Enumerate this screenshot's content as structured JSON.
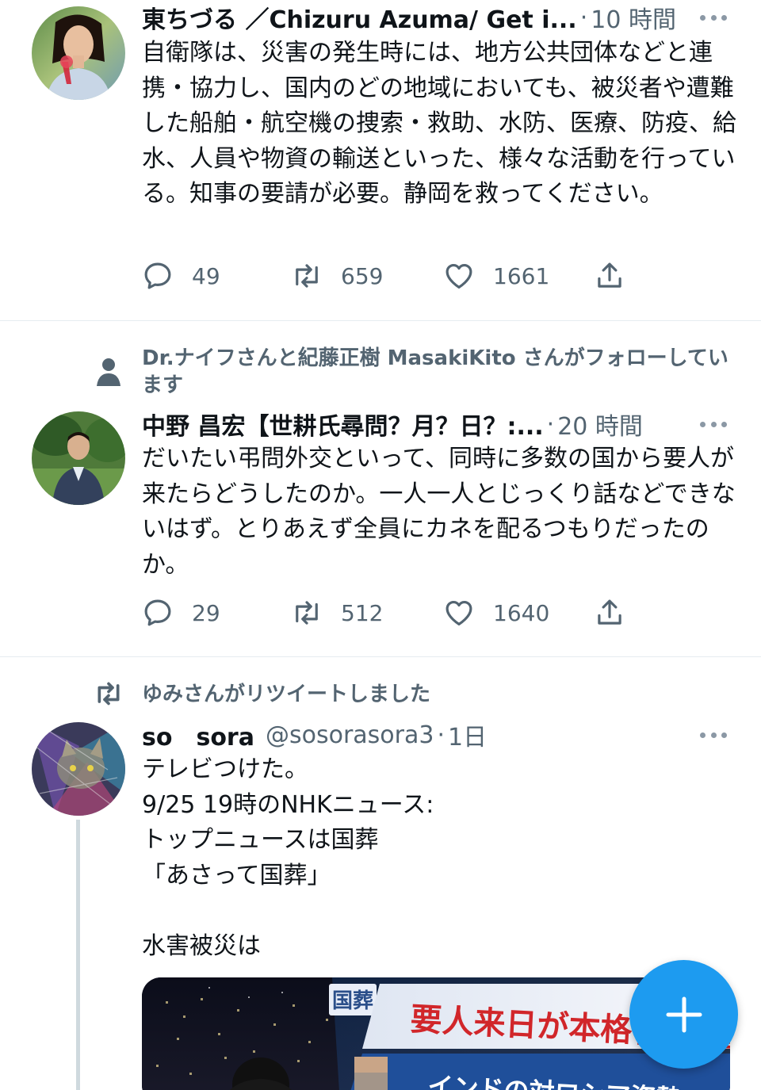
{
  "tweets": [
    {
      "author_name": "東ちづる ／Chizuru Azuma/ Get i...",
      "separator": "·",
      "time": "10 時間",
      "text": "自衛隊は、災害の発生時には、地方公共団体などと連携・協力し、国内のどの地域においても、被災者や遭難した船舶・航空機の捜索・救助、水防、医療、防疫、給水、人員や物資の輸送といった、様々な活動を行っている。知事の要請が必要。静岡を救ってください。",
      "replies": "49",
      "retweets": "659",
      "likes": "1661"
    },
    {
      "context": "Dr.ナイフさんと紀藤正樹 MasakiKito さんがフォローしています",
      "author_name": "中野 昌宏【世耕氏尋問？月？日？:...",
      "separator": "·",
      "time": "20 時間",
      "text": "だいたい弔問外交といって、同時に多数の国から要人が来たらどうしたのか。一人一人とじっくり話などできないはず。とりあえず全員にカネを配るつもりだったのか。",
      "replies": "29",
      "retweets": "512",
      "likes": "1640"
    },
    {
      "context": "ゆみさんがリツイートしました",
      "author_name": "so　sora",
      "handle": "@sosorasora3",
      "separator": "·",
      "time": "1日",
      "text": "テレビつけた。\n9/25 19時のNHKニュース:\nトップニュースは国葬\n「あさって国葬」\n\n水害被災は",
      "media": {
        "tag": "国葬",
        "headline": "要人来日が本格化 厳重",
        "subline": "インドの対ロシア姿勢"
      }
    }
  ],
  "icons": {
    "reply": "reply-icon",
    "retweet": "retweet-icon",
    "like": "heart-icon",
    "share": "share-icon",
    "more": "more-icon",
    "person": "person-icon",
    "compose": "plus-icon"
  },
  "colors": {
    "accent": "#1d9bf0",
    "muted": "#536471",
    "divider": "#e6ecf0"
  }
}
